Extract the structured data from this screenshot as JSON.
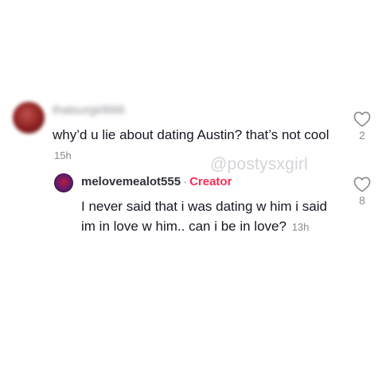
{
  "comments": [
    {
      "username": "thatsurgirl666",
      "text": "why’d u lie about dating Austin? that’s not cool",
      "timestamp": "15h",
      "likes": "2"
    }
  ],
  "reply": {
    "username": "melovemealot555",
    "separator": "·",
    "badge": "Creator",
    "text": "I never said that i was dating w him i said im in love w him.. can i be in love?",
    "timestamp": "13h",
    "likes": "8"
  },
  "watermark": "@postysxgirl",
  "icons": {
    "like": "heart-outline-icon"
  },
  "colors": {
    "creator_badge": "#fe2c55",
    "secondary_text": "#8a8b91",
    "primary_text": "#161823"
  }
}
